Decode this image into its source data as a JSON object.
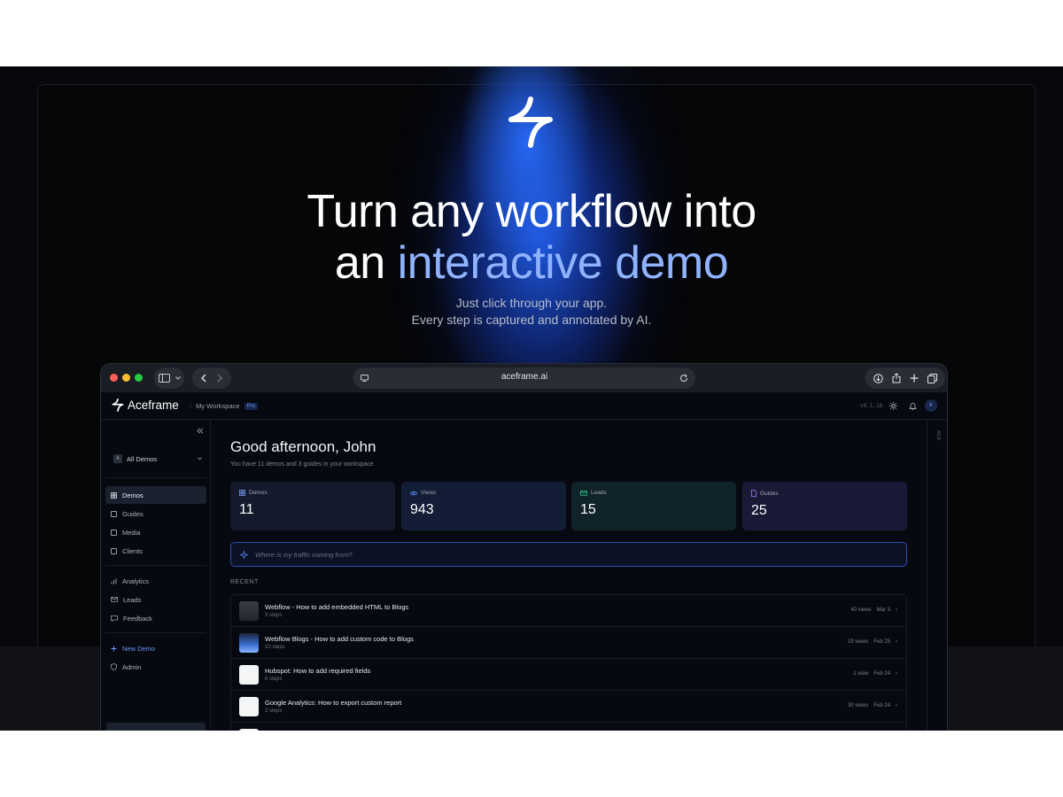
{
  "hero": {
    "headline_line1": "Turn any workflow into",
    "headline_prefix": "an ",
    "headline_accent": "interactive demo",
    "sub_line1": "Just click through your app.",
    "sub_line2": "Every step is captured and annotated by AI.",
    "accent_color": "#8fb3ff"
  },
  "browser": {
    "url": "aceframe.ai"
  },
  "app": {
    "brand": "Aceframe",
    "workspace": "My Workspace",
    "plan_badge": "Pro",
    "version": "v0.1.18",
    "avatar_initial": "F",
    "rail_label": "ACE",
    "sidebar": {
      "workspace_badge": "A",
      "workspace_select": "All Demos",
      "items": [
        {
          "label": "Demos",
          "icon": "grid-icon"
        },
        {
          "label": "Guides",
          "icon": "document-icon"
        },
        {
          "label": "Media",
          "icon": "image-icon"
        },
        {
          "label": "Clients",
          "icon": "contact-icon"
        },
        {
          "label": "Analytics",
          "icon": "bar-chart-icon"
        },
        {
          "label": "Leads",
          "icon": "mail-icon"
        },
        {
          "label": "Feedback",
          "icon": "chat-icon"
        },
        {
          "label": "New Demo",
          "icon": "plus-icon"
        },
        {
          "label": "Admin",
          "icon": "shield-icon"
        }
      ]
    },
    "greeting": "Good afternoon, John",
    "greeting_sub": "You have 11 demos and 3 guides in your workspace",
    "stats": [
      {
        "label": "Demos",
        "value": "11",
        "color": "#7ea2ff"
      },
      {
        "label": "Views",
        "value": "943",
        "color": "#5b8cff"
      },
      {
        "label": "Leads",
        "value": "15",
        "color": "#35c98b"
      },
      {
        "label": "Guides",
        "value": "25",
        "color": "#a77bff"
      }
    ],
    "ask_placeholder": "Where is my traffic coming from?",
    "recent_heading": "RECENT",
    "recent": [
      {
        "title": "Webflow - How to add embedded HTML to Blogs",
        "steps": "3 steps",
        "views": "40 views",
        "date": "Mar 3"
      },
      {
        "title": "Webflow Blogs - How to add custom code to Blogs",
        "steps": "10 steps",
        "views": "19 views",
        "date": "Feb 25"
      },
      {
        "title": "Hubspot: How to add required fields",
        "steps": "6 steps",
        "views": "1 view",
        "date": "Feb 24"
      },
      {
        "title": "Google Analytics: How to export custom report",
        "steps": "3 steps",
        "views": "30 views",
        "date": "Feb 24"
      }
    ]
  }
}
